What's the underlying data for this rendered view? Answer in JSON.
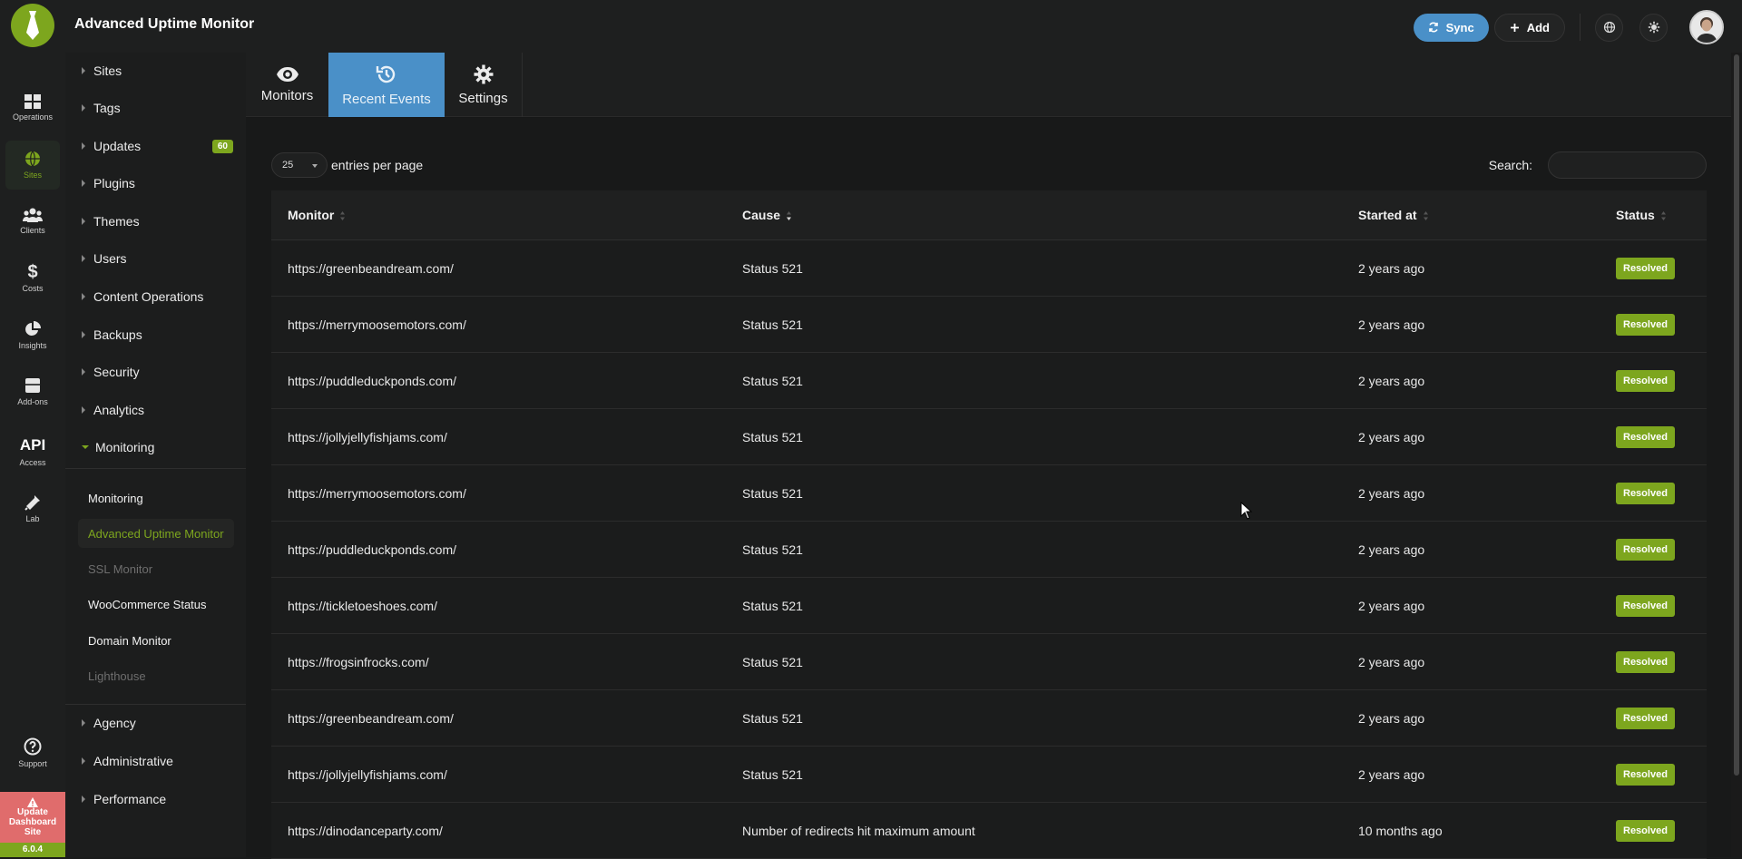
{
  "app": {
    "title": "Advanced Uptime Monitor"
  },
  "topbar": {
    "sync_label": "Sync",
    "add_label": "Add",
    "icons": [
      "globe-icon",
      "settings-icon",
      "avatar"
    ]
  },
  "rail": {
    "items": [
      {
        "label": "Operations",
        "icon": "grid-icon"
      },
      {
        "label": "Sites",
        "icon": "globe-icon"
      },
      {
        "label": "Clients",
        "icon": "users-icon"
      },
      {
        "label": "Costs",
        "icon": "dollar-icon"
      },
      {
        "label": "Insights",
        "icon": "pie-chart-icon"
      },
      {
        "label": "Add-ons",
        "icon": "box-icon"
      },
      {
        "label": "Access",
        "icon": "api-text",
        "big": "API"
      },
      {
        "label": "Lab",
        "icon": "flask-icon"
      },
      {
        "label": "Support",
        "icon": "help-icon"
      }
    ],
    "update": {
      "label": "Update Dashboard Site",
      "version": "6.0.4"
    }
  },
  "sidebar": {
    "items": [
      {
        "label": "Sites"
      },
      {
        "label": "Tags"
      },
      {
        "label": "Updates",
        "badge": "60"
      },
      {
        "label": "Plugins"
      },
      {
        "label": "Themes"
      },
      {
        "label": "Users"
      },
      {
        "label": "Content Operations"
      },
      {
        "label": "Backups"
      },
      {
        "label": "Security"
      },
      {
        "label": "Analytics"
      },
      {
        "label": "Monitoring"
      }
    ],
    "monitoring_sub": [
      {
        "label": "Monitoring"
      },
      {
        "label": "Advanced Uptime Monitor"
      },
      {
        "label": "SSL Monitor"
      },
      {
        "label": "WooCommerce Status"
      },
      {
        "label": "Domain Monitor"
      },
      {
        "label": "Lighthouse"
      }
    ],
    "bottom_items": [
      {
        "label": "Agency"
      },
      {
        "label": "Administrative"
      },
      {
        "label": "Performance"
      }
    ]
  },
  "tabs": [
    {
      "label": "Monitors",
      "icon": "eye-icon"
    },
    {
      "label": "Recent Events",
      "icon": "history-icon",
      "active": true
    },
    {
      "label": "Settings",
      "icon": "gear-icon"
    }
  ],
  "table_controls": {
    "page_length": "25",
    "length_label": "entries per page",
    "search_label": "Search:",
    "search_value": ""
  },
  "table": {
    "columns": [
      "Monitor",
      "Cause",
      "Started at",
      "Status"
    ],
    "rows": [
      {
        "monitor": "https://greenbeandream.com/",
        "cause": "Status 521",
        "started": "2 years ago",
        "status": "Resolved"
      },
      {
        "monitor": "https://merrymoosemotors.com/",
        "cause": "Status 521",
        "started": "2 years ago",
        "status": "Resolved"
      },
      {
        "monitor": "https://puddleduckponds.com/",
        "cause": "Status 521",
        "started": "2 years ago",
        "status": "Resolved"
      },
      {
        "monitor": "https://jollyjellyfishjams.com/",
        "cause": "Status 521",
        "started": "2 years ago",
        "status": "Resolved"
      },
      {
        "monitor": "https://merrymoosemotors.com/",
        "cause": "Status 521",
        "started": "2 years ago",
        "status": "Resolved"
      },
      {
        "monitor": "https://puddleduckponds.com/",
        "cause": "Status 521",
        "started": "2 years ago",
        "status": "Resolved"
      },
      {
        "monitor": "https://tickletoeshoes.com/",
        "cause": "Status 521",
        "started": "2 years ago",
        "status": "Resolved"
      },
      {
        "monitor": "https://frogsinfrocks.com/",
        "cause": "Status 521",
        "started": "2 years ago",
        "status": "Resolved"
      },
      {
        "monitor": "https://greenbeandream.com/",
        "cause": "Status 521",
        "started": "2 years ago",
        "status": "Resolved"
      },
      {
        "monitor": "https://jollyjellyfishjams.com/",
        "cause": "Status 521",
        "started": "2 years ago",
        "status": "Resolved"
      },
      {
        "monitor": "https://dinodanceparty.com/",
        "cause": "Number of redirects hit maximum amount",
        "started": "10 months ago",
        "status": "Resolved"
      }
    ]
  },
  "colors": {
    "accent": "#7da61e",
    "tab_active": "#4a90c8",
    "update_box": "#e06c6c"
  }
}
